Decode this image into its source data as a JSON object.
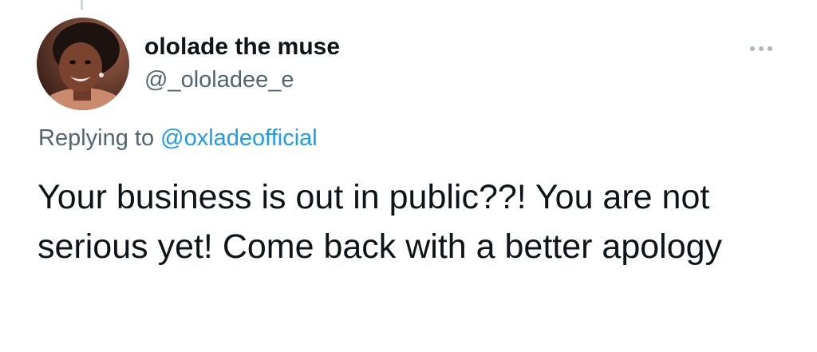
{
  "tweet": {
    "author": {
      "display_name": "ololade the muse",
      "handle": "@_ololadee_e",
      "avatar_icon": "profile-photo"
    },
    "replying_to_label": "Replying to",
    "replying_to_handle": "@oxladeofficial",
    "text": "Your business is out in public??! You are not serious yet! Come back with a better apology",
    "more_icon": "more-horizontal-icon"
  },
  "colors": {
    "primary_text": "#0f1419",
    "secondary_text": "#536471",
    "link": "#1d9bf0",
    "thread_line": "#cfd9de",
    "more_dots": "#aab8c2"
  }
}
